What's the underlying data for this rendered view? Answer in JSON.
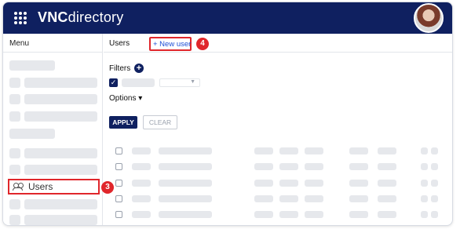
{
  "app": {
    "brand_bold": "VNC",
    "brand_rest": "directory",
    "icons": {
      "apps": "apps-grid-icon",
      "avatar": "user-avatar"
    }
  },
  "sidebar": {
    "menu_label": "Menu",
    "users_label": "Users",
    "users_icon": "users-icon",
    "callout_number": "3"
  },
  "main": {
    "tab_label": "Users",
    "new_user_label": "+ New user",
    "callout_number": "4",
    "filters_label": "Filters",
    "add_filter_icon": "plus-circle-icon",
    "options_label": "Options",
    "options_caret": "▾",
    "apply_label": "APPLY",
    "clear_label": "CLEAR"
  },
  "colors": {
    "header_bg": "#0f2060",
    "accent_red": "#e0262b",
    "link_blue": "#1d4fd6",
    "placeholder": "#e6e8ec"
  }
}
